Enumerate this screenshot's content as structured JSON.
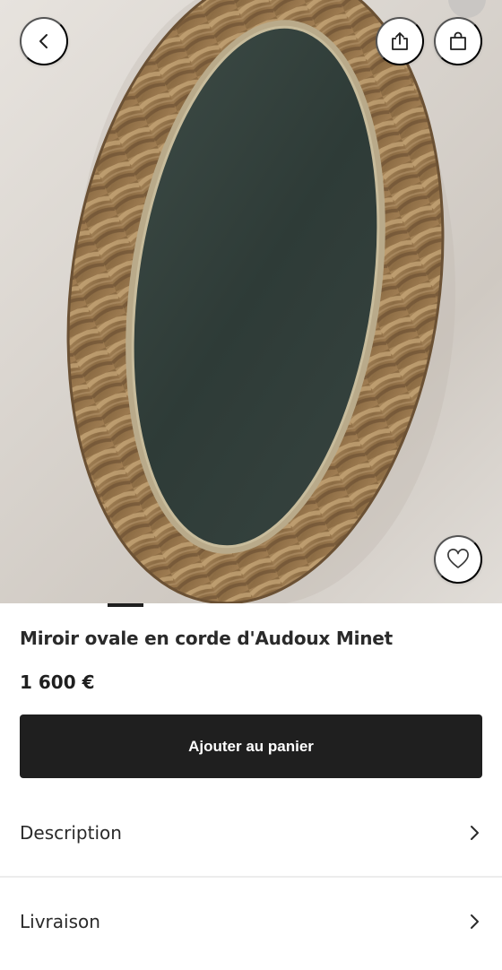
{
  "product": {
    "title": "Miroir ovale en corde d'Audoux Minet",
    "price": "1 600 €",
    "add_to_cart_label": "Ajouter au panier"
  },
  "sections": [
    {
      "label": "Description",
      "icon": "chevron-right-icon"
    },
    {
      "label": "Livraison",
      "icon": "chevron-right-icon"
    }
  ],
  "header": {
    "icons": [
      "chevron-left-icon",
      "share-icon",
      "shopping-bag-icon"
    ]
  },
  "gallery": {
    "favorite_icon": "heart-icon"
  },
  "colors": {
    "primary_button": "#1f1f1f",
    "button_text": "#ffffff",
    "background": "#ffffff"
  }
}
